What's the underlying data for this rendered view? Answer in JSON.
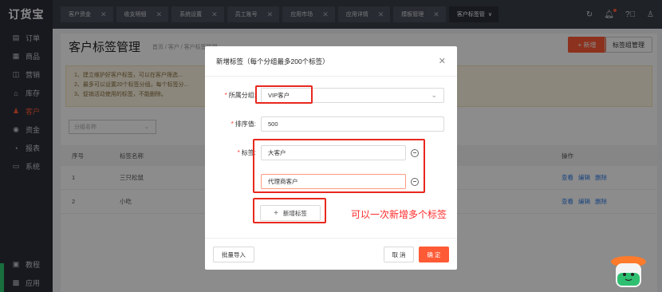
{
  "app": {
    "logo": "订货宝"
  },
  "sidebar": {
    "items": [
      {
        "icon": "order-icon",
        "glyph": "▤",
        "label": "订单"
      },
      {
        "icon": "goods-icon",
        "glyph": "▦",
        "label": "商品"
      },
      {
        "icon": "marketing-icon",
        "glyph": "◫",
        "label": "营销"
      },
      {
        "icon": "inventory-icon",
        "glyph": "⌂",
        "label": "库存"
      },
      {
        "icon": "customer-icon",
        "glyph": "♟",
        "label": "客户"
      },
      {
        "icon": "funds-icon",
        "glyph": "◉",
        "label": "资金"
      },
      {
        "icon": "report-icon",
        "glyph": "◔",
        "label": "报表"
      },
      {
        "icon": "system-icon",
        "glyph": "▭",
        "label": "系统"
      }
    ],
    "active_index": 4,
    "bottom": [
      {
        "icon": "tutorial-icon",
        "glyph": "▣",
        "label": "教程"
      },
      {
        "icon": "apps-icon",
        "glyph": "▩",
        "label": "应用"
      }
    ]
  },
  "tabs": [
    {
      "label": "客户资金"
    },
    {
      "label": "收支明细"
    },
    {
      "label": "系统设置"
    },
    {
      "label": "员工账号"
    },
    {
      "label": "应用市场"
    },
    {
      "label": "应用详情"
    },
    {
      "label": "模板管理"
    },
    {
      "label": "客户标签管"
    }
  ],
  "page": {
    "title": "客户标签管理",
    "breadcrumb": "首页 / 客户 / 客户标签管理",
    "add_button": "+ 新增",
    "group_manage_button": "标签组管理",
    "notice": [
      "1、建立维护好客户标签，可以在客户筛选...",
      "2、最多可以设置20个标签分组，每个标签分...",
      "3、促销活动使用的标签，不能删除。"
    ],
    "filter_placeholder": "分组名称",
    "table": {
      "headers": [
        "序号",
        "标签名称",
        "操作"
      ],
      "rows": [
        {
          "index": "1",
          "name": "三只松鼠",
          "ops": [
            "查看",
            "编辑",
            "删除"
          ]
        },
        {
          "index": "2",
          "name": "小吃",
          "ops": [
            "查看",
            "编辑",
            "删除"
          ]
        }
      ]
    }
  },
  "modal": {
    "title": "新增标签（每个分组最多200个标签）",
    "group_label": "所属分组:",
    "group_value": "VIP客户",
    "sort_label": "排序值:",
    "sort_value": "500",
    "tag_label": "标签:",
    "tags": [
      "大客户",
      "代理商客户"
    ],
    "add_tag_button": "新增标签",
    "import_button": "批量导入",
    "cancel_button": "取 消",
    "ok_button": "确 定"
  },
  "annotation": {
    "text": "可以一次新增多个标签"
  },
  "colors": {
    "accent": "#ff5a36",
    "annotation": "#e8281e",
    "link": "#2f7ae5"
  }
}
